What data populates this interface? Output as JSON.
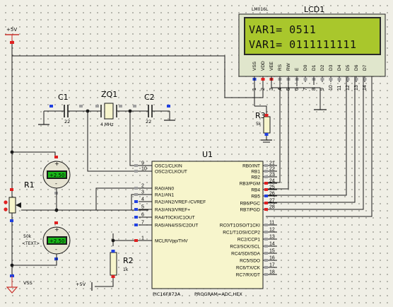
{
  "lcd": {
    "label": "LCD1",
    "part": "LM016L",
    "line1": "VAR1= 0511",
    "line2": "VAR1= 0111111111",
    "pins": [
      "VSS",
      "VDD",
      "VEE",
      "RS",
      "RW",
      "E",
      "D0",
      "D1",
      "D2",
      "D3",
      "D4",
      "D5",
      "D6",
      "D7"
    ],
    "pin_numbers": [
      "1",
      "2",
      "3",
      "4",
      "5",
      "6",
      "7",
      "8",
      "9",
      "10",
      "11",
      "12",
      "13",
      "14"
    ]
  },
  "mcu": {
    "label": "U1",
    "part": "PIC16F873A",
    "program": "PROGRAM=ADC.HEX",
    "left_pins": [
      {
        "num": "9",
        "name": "OSC1/CLKIN"
      },
      {
        "num": "10",
        "name": "OSC2/CLKOUT"
      },
      {
        "num": "2",
        "name": "RA0/AN0"
      },
      {
        "num": "3",
        "name": "RA1/AN1"
      },
      {
        "num": "4",
        "name": "RA2/AN2/VREF-/CVREF"
      },
      {
        "num": "5",
        "name": "RA3/AN3/VREF+"
      },
      {
        "num": "6",
        "name": "RA4/T0CKI/C1OUT"
      },
      {
        "num": "7",
        "name": "RA5/AN4/SS/C2OUT"
      },
      {
        "num": "1",
        "name": "MCLR/Vpp/THV"
      }
    ],
    "right_pins": [
      {
        "num": "21",
        "name": "RB0/INT"
      },
      {
        "num": "22",
        "name": "RB1"
      },
      {
        "num": "23",
        "name": "RB2"
      },
      {
        "num": "24",
        "name": "RB3/PGM"
      },
      {
        "num": "25",
        "name": "RB4"
      },
      {
        "num": "26",
        "name": "RB5"
      },
      {
        "num": "27",
        "name": "RB6/PGC"
      },
      {
        "num": "28",
        "name": "RB7/PGD"
      },
      {
        "num": "11",
        "name": "RC0/T1OSO/T1CKI"
      },
      {
        "num": "12",
        "name": "RC1/T1OSI/CCP2"
      },
      {
        "num": "13",
        "name": "RC2/CCP1"
      },
      {
        "num": "14",
        "name": "RC3/SCK/SCL"
      },
      {
        "num": "15",
        "name": "RC4/SDI/SDA"
      },
      {
        "num": "16",
        "name": "RC5/SDO"
      },
      {
        "num": "17",
        "name": "RC6/TX/CK"
      },
      {
        "num": "18",
        "name": "RC7/RX/DT"
      }
    ]
  },
  "power": {
    "vdd_top": "+5V",
    "vss_bottom": "VSS",
    "vdd_r2": "+5V"
  },
  "c1": {
    "label": "C1",
    "value": "22"
  },
  "c2": {
    "label": "C2",
    "value": "22"
  },
  "crystal": {
    "label": "ZQ1",
    "value": "4 MHz"
  },
  "r1": {
    "label": "R1",
    "value": "50k",
    "text": "<TEXT>"
  },
  "r2": {
    "label": "R2",
    "value": "1k"
  },
  "r3": {
    "label": "R3",
    "value": "5k"
  },
  "voltmeter_top": {
    "reading": "+2.50"
  },
  "voltmeter_bottom": {
    "reading": "+2.50"
  },
  "colors": {
    "accent": "#c8302a",
    "wire": "#1a1a1a",
    "pin_red": "#e02020",
    "pin_blue": "#2040e0",
    "lcd_screen": "#a9c72c",
    "body_fill": "#f7f5cc",
    "meter_display": "#18b818"
  }
}
